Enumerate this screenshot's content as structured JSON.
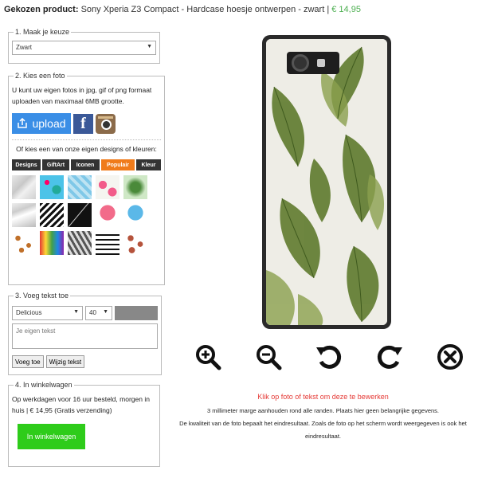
{
  "header": {
    "label": "Gekozen product:",
    "product": "Sony Xperia Z3 Compact - Hardcase hoesje ontwerpen - zwart |",
    "price": "€ 14,95"
  },
  "step1": {
    "legend": "1. Maak je keuze",
    "select_value": "Zwart"
  },
  "step2": {
    "legend": "2. Kies een foto",
    "description": "U kunt uw eigen fotos in jpg, gif of png formaat uploaden van maximaal 6MB grootte.",
    "upload_label": "upload",
    "designs_intro": "Of kies een van onze eigen designs of kleuren:",
    "tabs": [
      "Designs",
      "GiftArt",
      "Iconen",
      "Populair",
      "Kleur"
    ],
    "active_tab": "Populair"
  },
  "step3": {
    "legend": "3. Voeg tekst toe",
    "font_value": "Delicious",
    "size_value": "40",
    "text_placeholder": "Je eigen tekst",
    "add_button": "Voeg toe",
    "edit_button": "Wijzig tekst"
  },
  "step4": {
    "legend": "4. In winkelwagen",
    "delivery_text": "Op werkdagen voor 16 uur besteld, morgen in huis | € 14,95 (Gratis verzending)",
    "cart_button": "In winkelwagen"
  },
  "editor": {
    "hint": "Klik op foto of tekst om deze te bewerken",
    "margin_note": "3 millimeter marge aanhouden rond alle randen. Plaats hier geen belangrijke gegevens.",
    "quality_note": "De kwaliteit van de foto bepaalt het eindresultaat. Zoals de foto op het scherm wordt weergegeven is ook het eindresultaat."
  },
  "icons": [
    "zoom-in-icon",
    "zoom-out-icon",
    "rotate-left-icon",
    "rotate-right-icon",
    "delete-icon"
  ],
  "colors": {
    "accent_orange": "#f07b1a",
    "price_green": "#4caf50",
    "upload_blue": "#3a8ee6",
    "cart_green": "#2ecc1a",
    "hint_red": "#e53935"
  }
}
